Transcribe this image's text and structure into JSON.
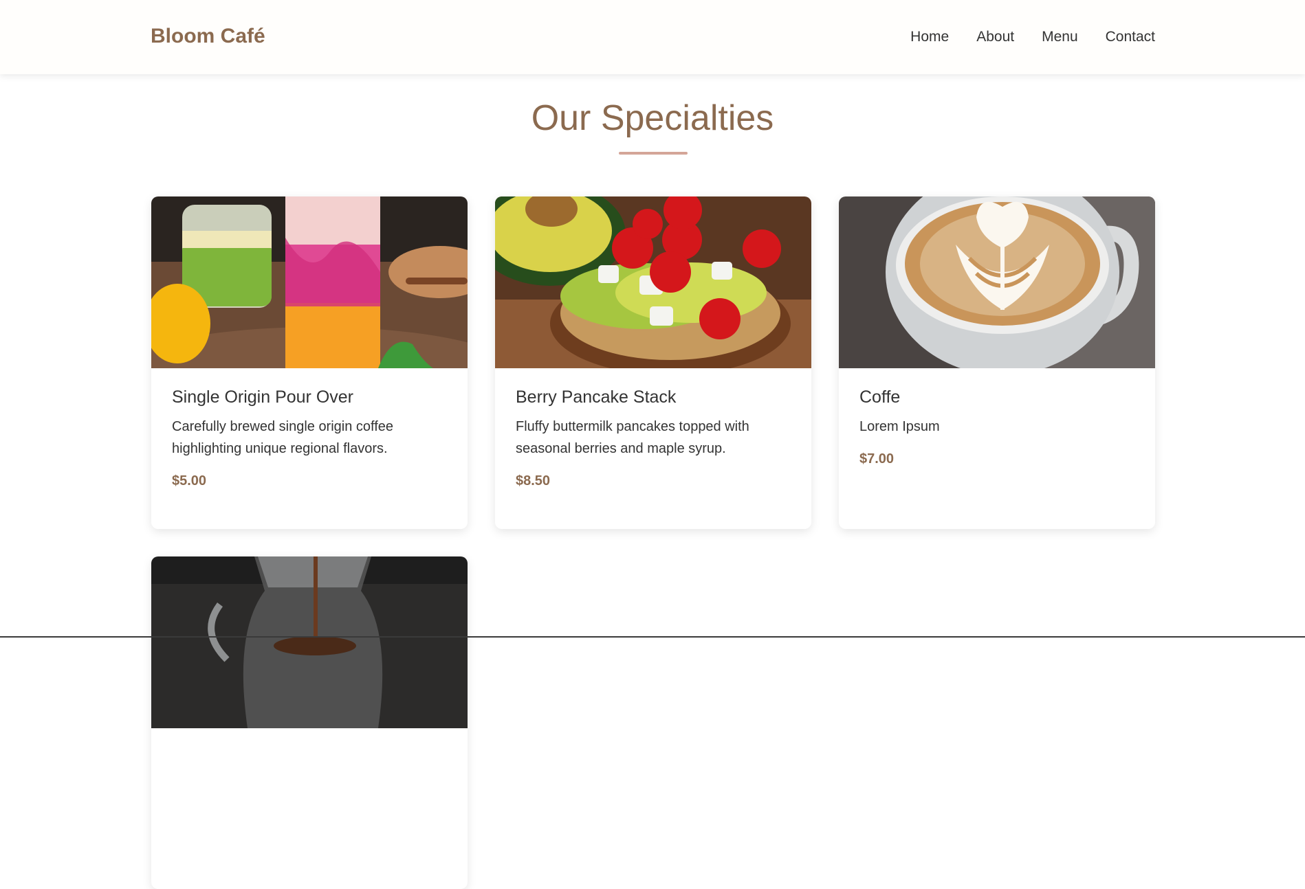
{
  "brand": {
    "name": "Bloom Café"
  },
  "nav": {
    "links": [
      "Home",
      "About",
      "Menu",
      "Contact"
    ]
  },
  "section": {
    "title": "Our Specialties"
  },
  "cards": [
    {
      "title": "Single Origin Pour Over",
      "description": "Carefully brewed single origin coffee highlighting unique regional flavors.",
      "price": "$5.00",
      "image_icon": "smoothie-drinks-photo"
    },
    {
      "title": "Berry Pancake Stack",
      "description": "Fluffy buttermilk pancakes topped with seasonal berries and maple syrup.",
      "price": "$8.50",
      "image_icon": "avocado-toast-photo"
    },
    {
      "title": "Coffe",
      "description": "Lorem Ipsum",
      "price": "$7.00",
      "image_icon": "latte-art-photo"
    },
    {
      "image_icon": "pour-over-carafe-photo"
    }
  ],
  "colors": {
    "accent": "#8b6a4f",
    "underline": "#d4a598",
    "text": "#333333",
    "navbar_bg": "#fffefc"
  }
}
